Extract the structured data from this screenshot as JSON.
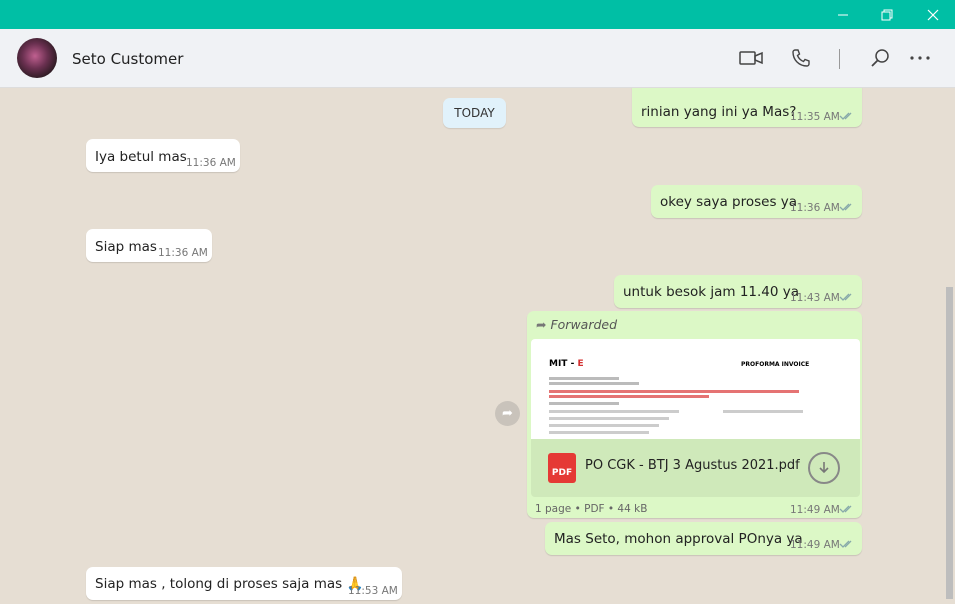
{
  "window": {
    "minimize_icon": "minimize-icon",
    "restore_icon": "restore-icon",
    "close_icon": "close-icon"
  },
  "header": {
    "contact_name": "Seto Customer",
    "icons": [
      "video-call-icon",
      "voice-call-icon",
      "search-icon",
      "more-options-icon"
    ]
  },
  "chat": {
    "date_divider": "TODAY",
    "messages": [
      {
        "direction": "out",
        "text": "rinian yang ini ya Mas?",
        "time": "11:35 AM",
        "status": "read"
      },
      {
        "direction": "in",
        "text": "Iya betul mas",
        "time": "11:36 AM"
      },
      {
        "direction": "out",
        "text": "okey saya proses ya",
        "time": "11:36 AM",
        "status": "read"
      },
      {
        "direction": "in",
        "text": "Siap mas",
        "time": "11:36 AM"
      },
      {
        "direction": "out",
        "text": "untuk besok jam 11.40 ya",
        "time": "11:43 AM",
        "status": "read"
      },
      {
        "direction": "out",
        "type": "document",
        "forwarded_label": "Forwarded",
        "file_name": "PO CGK - BTJ 3 Agustus 2021.pdf",
        "file_type_badge": "PDF",
        "file_meta": "1 page • PDF • 44 kB",
        "time": "11:49 AM",
        "status": "read",
        "preview_title": "PROFORMA INVOICE",
        "preview_logo": "MIT - ",
        "preview_logo_accent": "E"
      },
      {
        "direction": "out",
        "text": "Mas Seto, mohon approval POnya ya",
        "time": "11:49 AM",
        "status": "read"
      },
      {
        "direction": "in",
        "text": "Siap mas , tolong di proses saja mas 🙏",
        "time": "11:53 AM"
      }
    ]
  },
  "colors": {
    "titlebar": "#00bfa5",
    "outgoing_bubble": "#dcf8c6",
    "incoming_bubble": "#ffffff",
    "chat_background": "#e6ded3",
    "read_ticks": "#4fc3f7"
  }
}
